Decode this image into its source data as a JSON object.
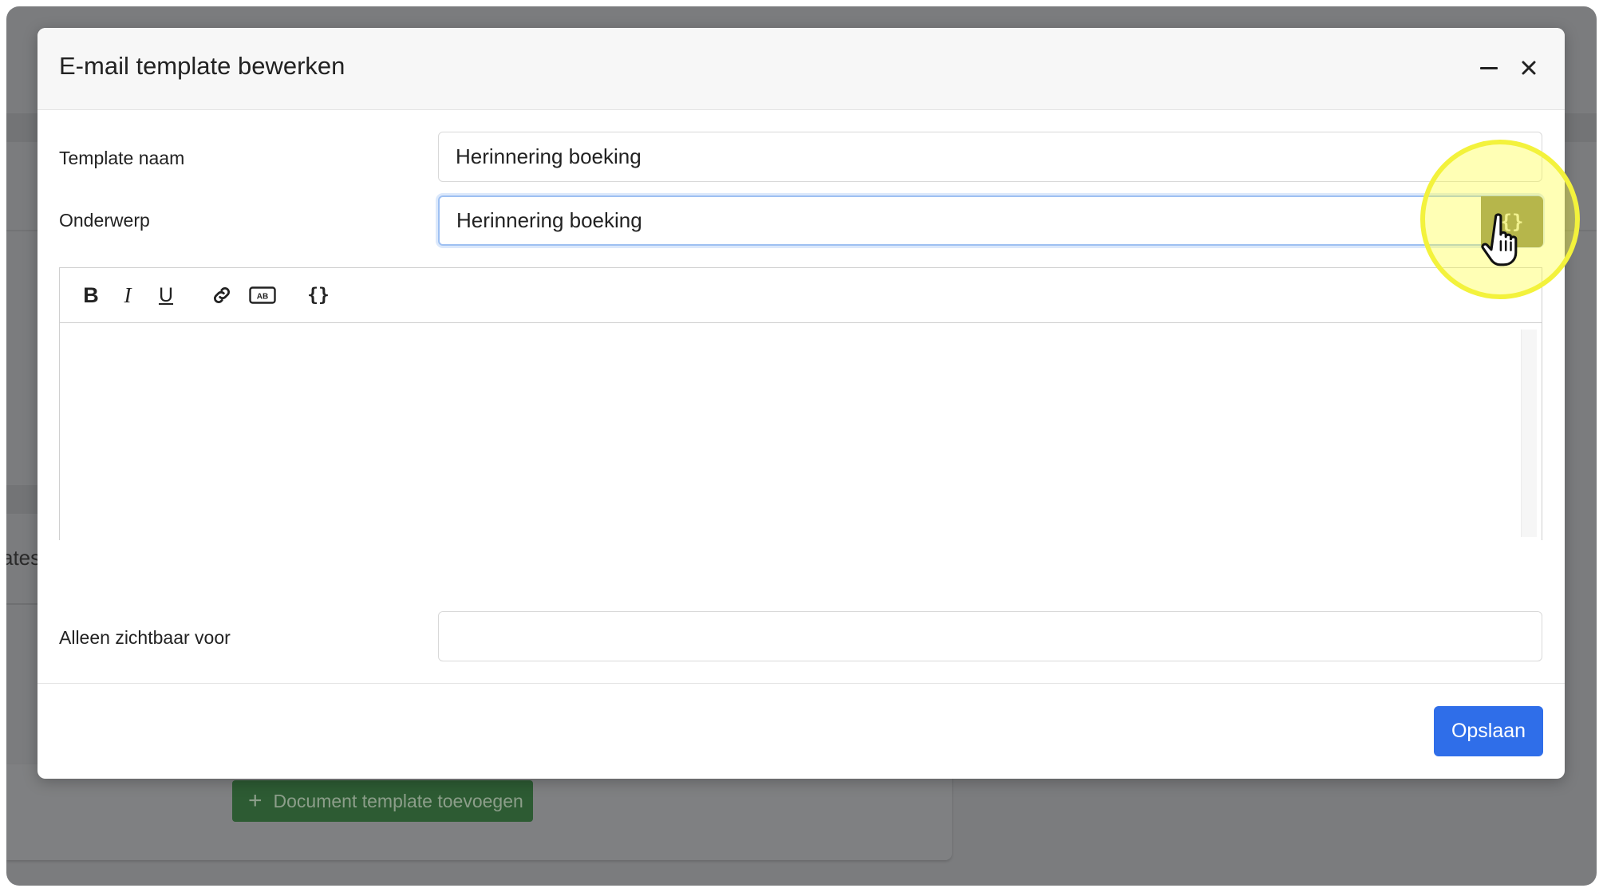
{
  "background": {
    "cut_off_text": "ates",
    "add_document_template_button": "Document template toevoegen"
  },
  "modal": {
    "title": "E-mail template bewerken",
    "minimize_icon": "minus-icon",
    "close_icon": "close-icon",
    "fields": {
      "template_name": {
        "label": "Template naam",
        "value": "Herinnering boeking"
      },
      "subject": {
        "label": "Onderwerp",
        "value": "Herinnering boeking",
        "variable_button_glyph": "{}"
      },
      "visible_for": {
        "label": "Alleen zichtbaar voor",
        "value": ""
      }
    },
    "editor": {
      "toolbar": [
        {
          "name": "bold",
          "glyph": "B"
        },
        {
          "name": "italic",
          "glyph": "I"
        },
        {
          "name": "underline",
          "glyph": "U"
        },
        {
          "name": "link",
          "icon": "link-icon"
        },
        {
          "name": "abbreviation",
          "glyph": "AB",
          "icon": "abbreviation-icon"
        },
        {
          "name": "variable",
          "glyph": "{}"
        }
      ],
      "content": ""
    },
    "save_button": "Opslaan"
  },
  "colors": {
    "primary": "#2f6ee9",
    "focus_border": "#9ec0f2",
    "highlight": "#f3f23c",
    "backdrop": "#7b7c7e",
    "document_button": "#2d5b33"
  }
}
